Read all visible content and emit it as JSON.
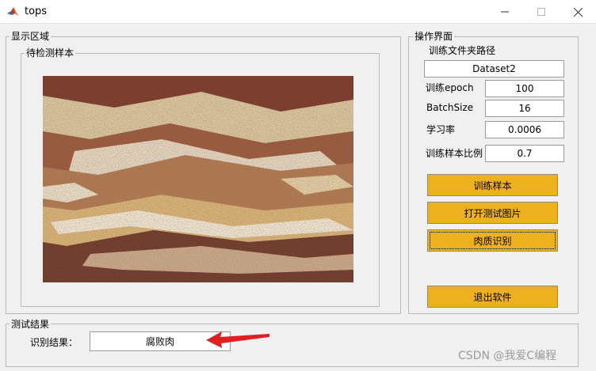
{
  "window": {
    "title": "tops"
  },
  "display_panel": {
    "title": "显示区域",
    "sample_panel_title": "待检测样本"
  },
  "ops_panel": {
    "title": "操作界面",
    "folder_label": "训练文件夹路径",
    "folder_value": "Dataset2",
    "epoch_label": "训练epoch",
    "epoch_value": "100",
    "batch_label": "BatchSize",
    "batch_value": "16",
    "lr_label": "学习率",
    "lr_value": "0.0006",
    "ratio_label": "训练样本比例",
    "ratio_value": "0.7",
    "buttons": {
      "train": "训练样本",
      "open_image": "打开测试图片",
      "identify": "肉质识别",
      "exit": "退出软件"
    }
  },
  "result_panel": {
    "title": "测试结果",
    "label": "识别结果：",
    "value": "腐败肉"
  },
  "watermark": "CSDN @我爱C编程",
  "colors": {
    "button": "#edb120",
    "arrow": "#e02020"
  }
}
